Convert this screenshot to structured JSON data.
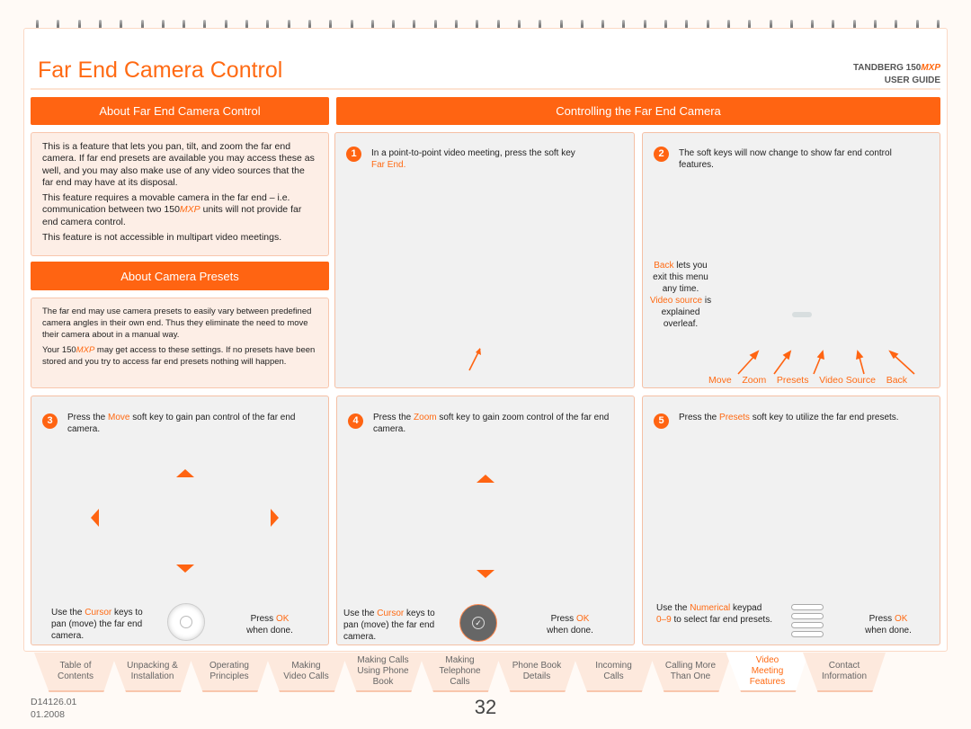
{
  "header": {
    "title": "Far End Camera Control",
    "brand": "TANDBERG 150",
    "brand_model": "MXP",
    "guide": "USER GUIDE"
  },
  "about": {
    "heading": "About Far End Camera Control",
    "p1": "This is a feature that lets you pan, tilt, and zoom the far end camera. If far end presets are available you may access these as well, and you may also make use of any video sources that the far end may have at its disposal.",
    "p2a": "This feature requires a movable camera in the far end – i.e. communication between two 150",
    "p2b": "MXP",
    "p2c": " units will not provide far end camera control.",
    "p3": "This feature is not accessible in multipart video meetings."
  },
  "presets": {
    "heading": "About Camera Presets",
    "p1": "The far end may use camera presets to easily vary between predefined camera angles in their own end. Thus they eliminate the need to move their camera about in a manual way.",
    "p2a": "Your 150",
    "p2b": "MXP",
    "p2c": " may get access to these settings. If no presets have been stored and you try to access far end presets nothing will happen."
  },
  "controlling": {
    "heading": "Controlling the Far End Camera"
  },
  "steps": [
    {
      "num": "1",
      "text": "In a point-to-point video meeting, press the soft key",
      "hl": "Far End."
    },
    {
      "num": "2",
      "text": "The soft keys will now change to show far end control features.",
      "note_back": "Back",
      "note_back_text": "lets you exit this menu any time.",
      "note_vs": "Video source",
      "note_vs_text": "is explained overleaf.",
      "softkeys": [
        "Move",
        "Zoom",
        "Presets",
        "Video Source",
        "Back"
      ]
    },
    {
      "num": "3",
      "pre": "Press the",
      "hl": "Move",
      "post": "soft key to gain pan control of the far end camera.",
      "use_pre": "Use the",
      "use_hl": "Cursor",
      "use_post": "keys to pan (move) the far end camera.",
      "press": "Press",
      "ok": "OK",
      "done": "when done."
    },
    {
      "num": "4",
      "pre": "Press the",
      "hl": "Zoom",
      "post": "soft key to gain zoom control of the far end camera.",
      "use_pre": "Use the",
      "use_hl": "Cursor",
      "use_post": "keys to pan (move) the far end camera.",
      "press": "Press",
      "ok": "OK",
      "done": "when done."
    },
    {
      "num": "5",
      "pre": "Press the",
      "hl": "Presets",
      "post": "soft key to utilize the far end presets.",
      "use_pre": "Use the",
      "use_hl": "Numerical",
      "use_post": "keypad",
      "use_hl2": "0–9",
      "use_post2": "to select far end presets.",
      "press": "Press",
      "ok": "OK",
      "done": "when done."
    }
  ],
  "tabs": [
    "Table of Contents",
    "Unpacking & Installation",
    "Operating Principles",
    "Making Video Calls",
    "Making Calls Using Phone Book",
    "Making Telephone Calls",
    "Phone Book Details",
    "Incoming Calls",
    "Calling More Than One",
    "Video Meeting Features",
    "Contact Information"
  ],
  "active_tab": "Video Meeting Features",
  "footer": {
    "doc": "D14126.01",
    "date": "01.2008",
    "page": "32"
  },
  "colors": {
    "accent": "#ff6412",
    "panel": "#fdeee6",
    "step_panel": "#f1f1f1"
  }
}
